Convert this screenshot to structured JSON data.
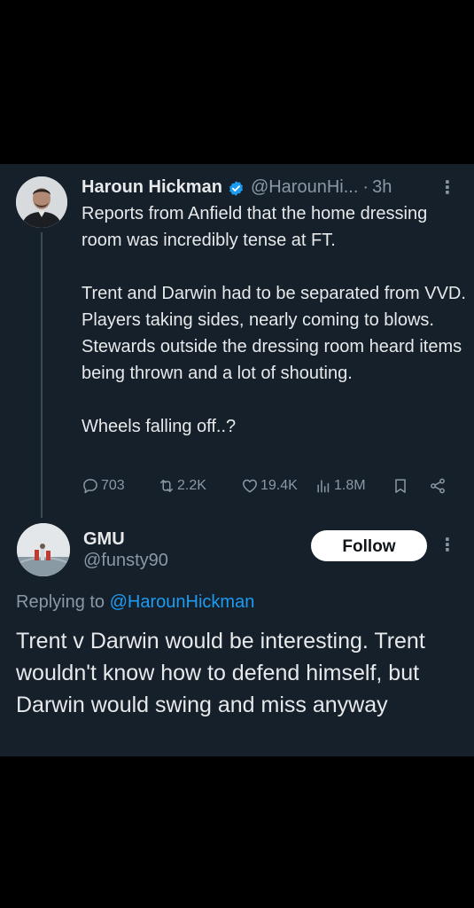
{
  "tweet": {
    "author_name": "Haroun Hickman",
    "author_handle": "@HarounHi...",
    "separator": "·",
    "time": "3h",
    "verified_color": "#1d9bf0",
    "text": "Reports from Anfield that the home dressing room was incredibly tense at FT.\n\nTrent and Darwin had to be separated from VVD. Players taking sides, nearly coming to blows. Stewards outside the dressing room heard items being thrown and a lot of shouting.\n\nWheels falling off..?",
    "stats": {
      "replies": "703",
      "reposts": "2.2K",
      "likes": "19.4K",
      "views": "1.8M"
    },
    "icons": [
      "reply-icon",
      "repost-icon",
      "like-icon",
      "views-icon",
      "bookmark-icon",
      "share-icon",
      "more-icon"
    ]
  },
  "reply": {
    "author_name": "GMU",
    "author_handle": "@funsty90",
    "follow_label": "Follow",
    "replying_prefix": "Replying to",
    "replying_handle": "@HarounHickman",
    "text": "Trent v Darwin would be interesting. Trent wouldn't know how to defend himself, but Darwin would swing and miss anyway",
    "mention_color": "#1d9bf0"
  },
  "theme": {
    "background": "#15202b",
    "primary_text": "#e7e9ea",
    "secondary_text": "#8b98a5"
  }
}
